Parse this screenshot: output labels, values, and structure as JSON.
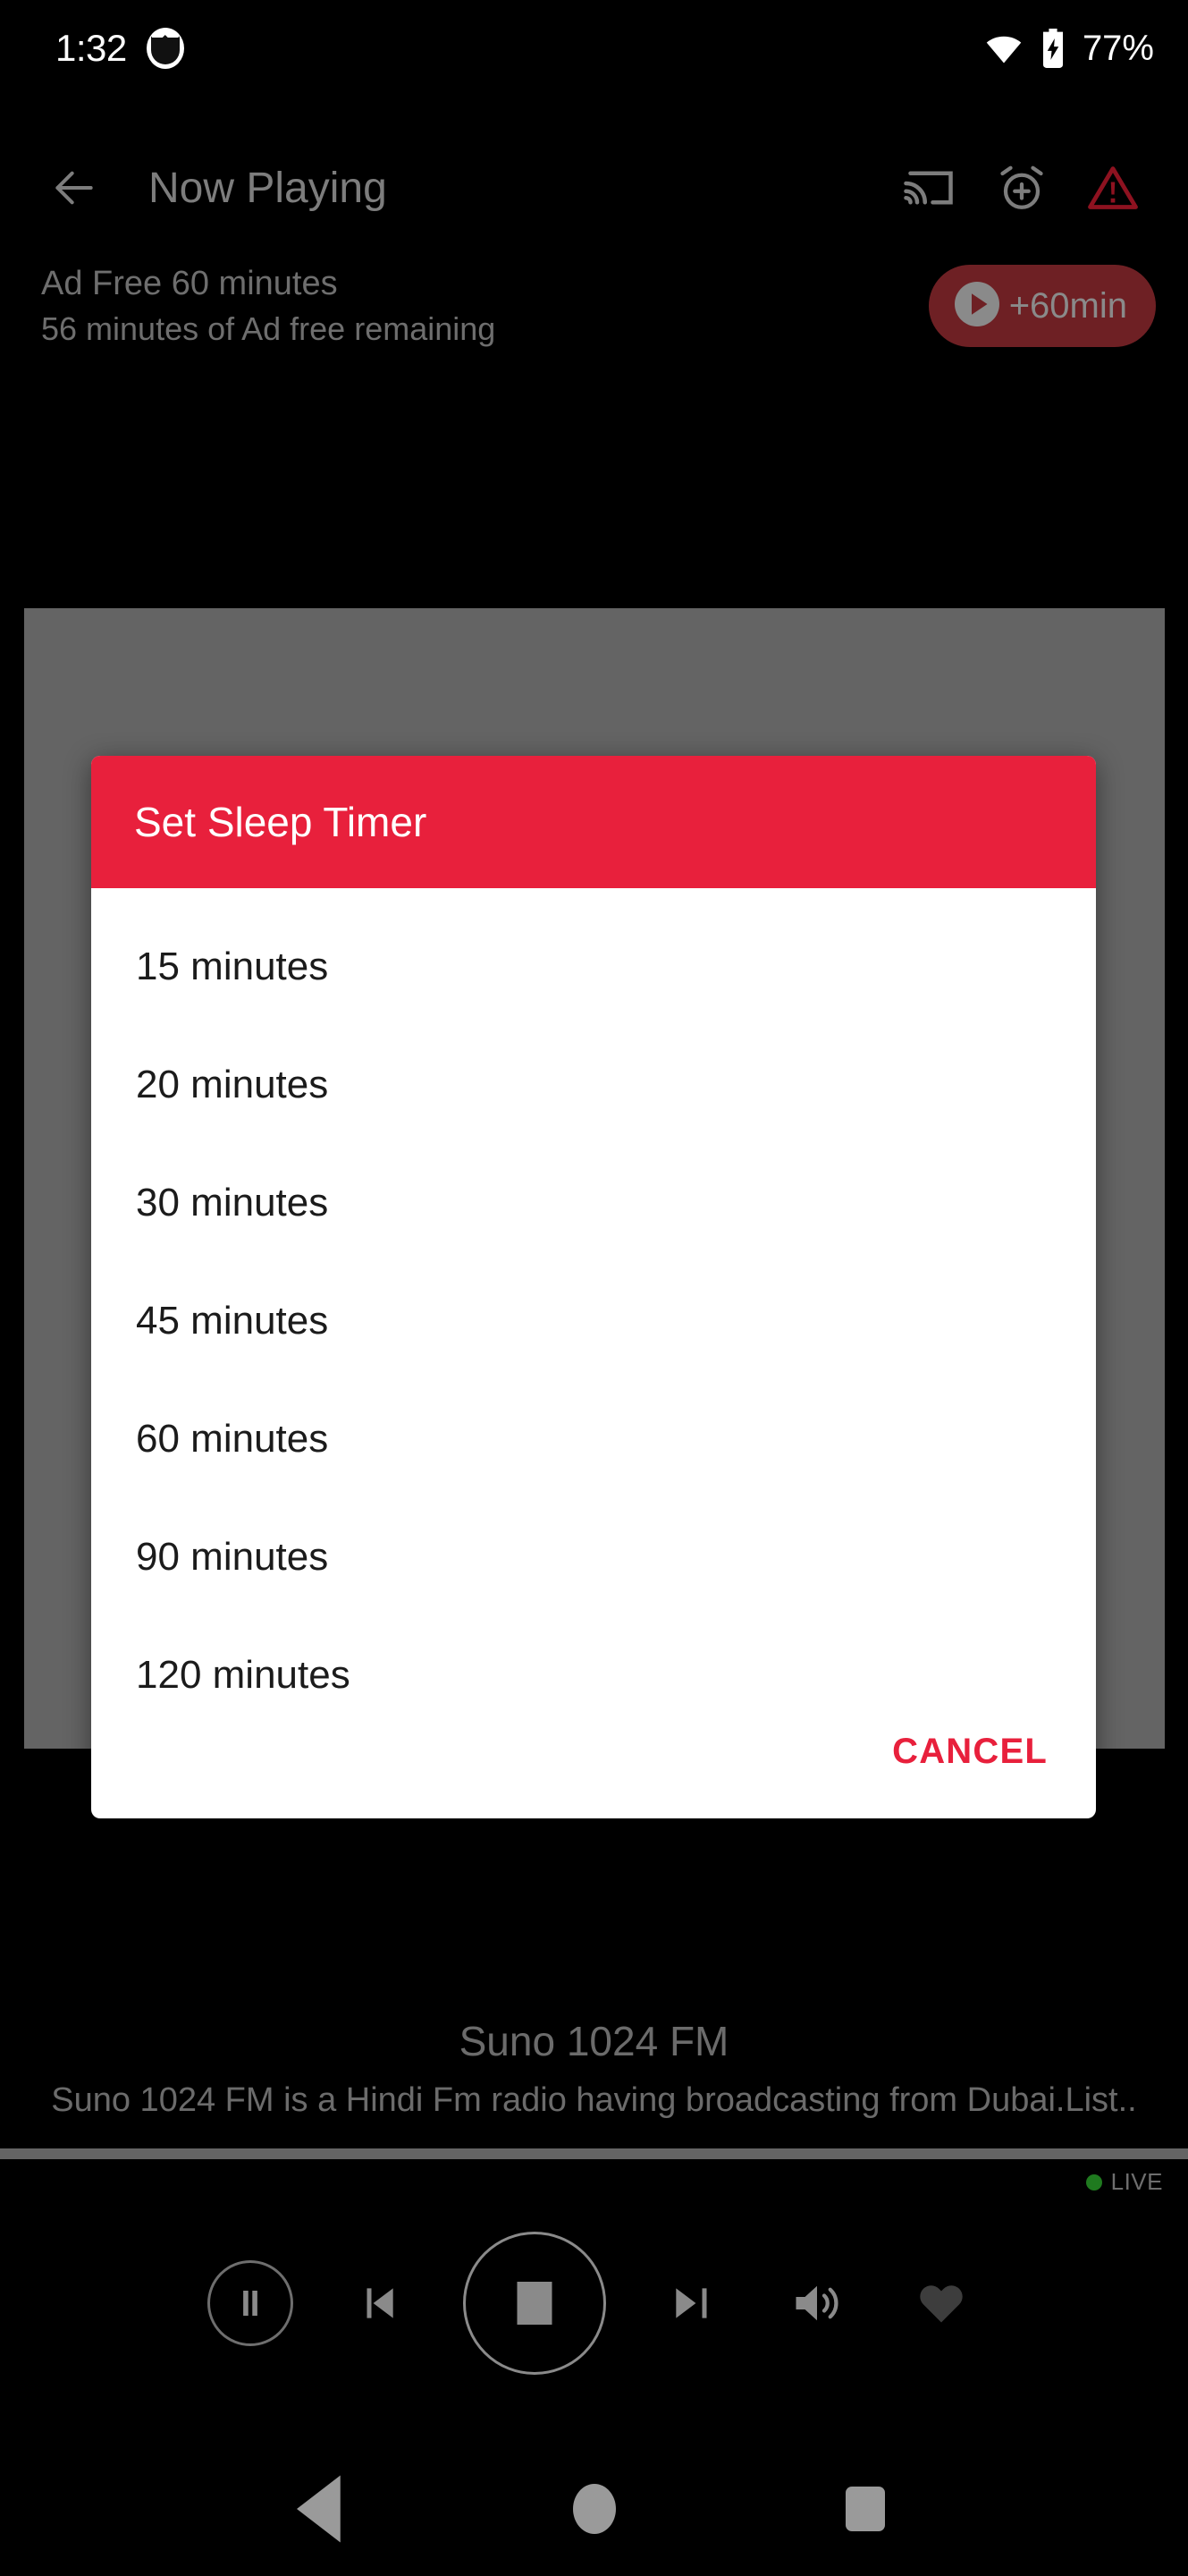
{
  "status_bar": {
    "clock": "1:32",
    "app_badge_icon": "cat-app-icon",
    "wifi_icon": "wifi-icon",
    "battery_icon": "battery-charging-icon",
    "battery_percent": "77%"
  },
  "app_bar": {
    "back_icon": "arrow-back-icon",
    "title": "Now Playing",
    "actions": [
      {
        "name": "cast-icon",
        "label": "Cast"
      },
      {
        "name": "alarm-add-icon",
        "label": "Sleep timer"
      },
      {
        "name": "warning-triangle-icon",
        "label": "Report"
      }
    ]
  },
  "ad_free": {
    "title": "Ad Free 60 minutes",
    "subtitle": "56 minutes of Ad free remaining",
    "button_icon": "play-circle-icon",
    "button_label": "+60min"
  },
  "dialog": {
    "title": "Set Sleep Timer",
    "options": [
      "15 minutes",
      "20 minutes",
      "30 minutes",
      "45 minutes",
      "60 minutes",
      "90 minutes",
      "120 minutes"
    ],
    "cancel_label": "CANCEL"
  },
  "station": {
    "name": "Suno 1024 FM",
    "description": "Suno 1024 FM is a Hindi Fm radio having broadcasting from Dubai.List.."
  },
  "player": {
    "live_label": "LIVE",
    "controls": [
      {
        "name": "pause-button",
        "label": "Pause"
      },
      {
        "name": "previous-button",
        "label": "Previous"
      },
      {
        "name": "stop-button",
        "label": "Stop"
      },
      {
        "name": "next-button",
        "label": "Next"
      },
      {
        "name": "volume-button",
        "label": "Volume"
      },
      {
        "name": "favorite-button",
        "label": "Favorite"
      }
    ]
  },
  "nav_bar": {
    "back_label": "Back",
    "home_label": "Home",
    "recents_label": "Recents"
  },
  "colors": {
    "accent_red": "#e8203c",
    "dim_red": "#6e2024",
    "scrim_grey": "#646464",
    "live_green": "#1f7a1f",
    "dim_text": "#6e6e6e"
  }
}
